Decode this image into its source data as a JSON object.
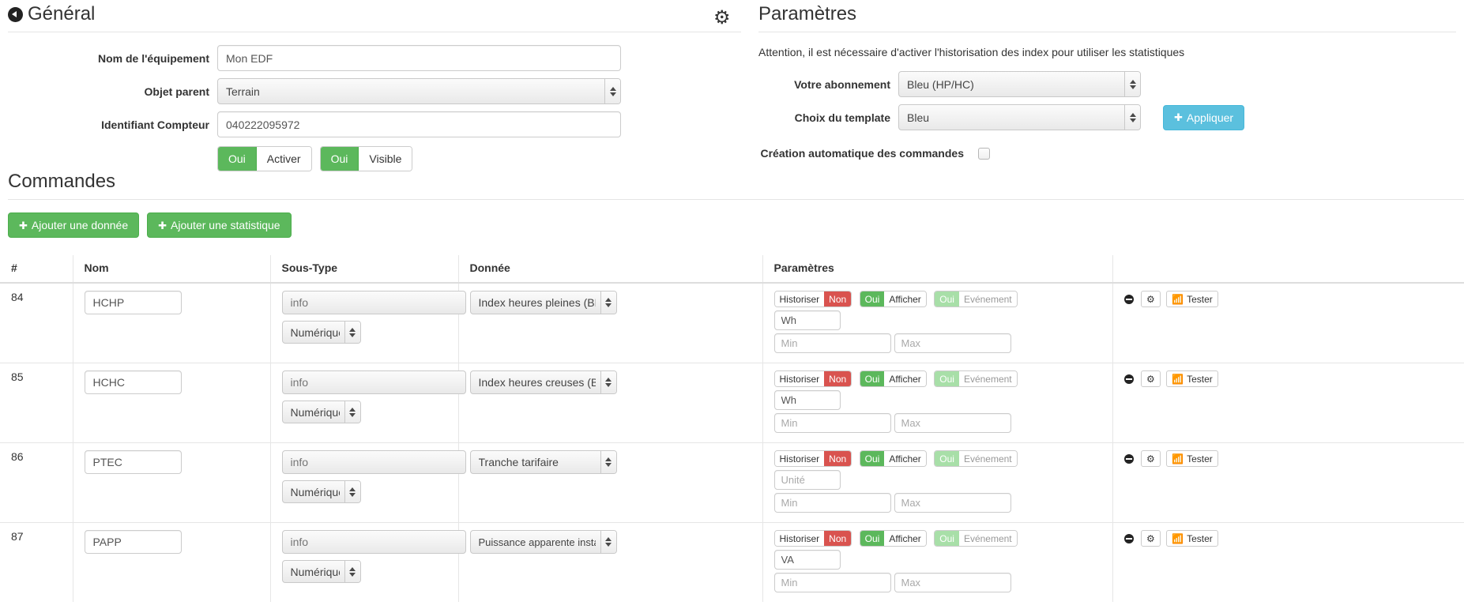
{
  "general": {
    "title": "Général",
    "back_icon": "back-arrow-icon",
    "gear_icon": "gears-icon",
    "fields": {
      "name_label": "Nom de l'équipement",
      "name_value": "Mon EDF",
      "parent_label": "Objet parent",
      "parent_value": "Terrain",
      "meter_label": "Identifiant Compteur",
      "meter_value": "040222095972"
    },
    "toggles": [
      {
        "state": "Oui",
        "label": "Activer"
      },
      {
        "state": "Oui",
        "label": "Visible"
      }
    ]
  },
  "parametres": {
    "title": "Paramètres",
    "warning": "Attention, il est nécessaire d'activer l'historisation des index pour utiliser les statistiques",
    "subscription_label": "Votre abonnement",
    "subscription_value": "Bleu (HP/HC)",
    "template_label": "Choix du template",
    "template_value": "Bleu",
    "apply_label": "Appliquer",
    "apply_icon": "plus-circle-icon",
    "auto_create_label": "Création automatique des commandes",
    "auto_create_checked": false
  },
  "commandes": {
    "title": "Commandes",
    "add_data_label": "Ajouter une donnée",
    "add_stat_label": "Ajouter une statistique",
    "columns": [
      "#",
      "Nom",
      "Sous-Type",
      "Donnée",
      "Paramètres",
      ""
    ],
    "param_labels": {
      "historiser": "Historiser",
      "historiser_state": "Non",
      "afficher": "Afficher",
      "afficher_state": "Oui",
      "evenement": "Evénement",
      "evenement_state": "Oui",
      "unit_placeholder": "Unité",
      "min_placeholder": "Min",
      "max_placeholder": "Max",
      "info_placeholder": "info"
    },
    "actions": {
      "delete_icon": "minus-circle-icon",
      "config_icon": "gears-icon",
      "test_icon": "rss-icon",
      "test_label": "Tester"
    },
    "rows": [
      {
        "id": "84",
        "nom": "HCHP",
        "sous_type_info": "",
        "sous_type_select": "Numérique",
        "donnee": "Index heures pleines (BLEU)",
        "unit": "Wh",
        "min": "",
        "max": ""
      },
      {
        "id": "85",
        "nom": "HCHC",
        "sous_type_info": "",
        "sous_type_select": "Numérique",
        "donnee": "Index heures creuses (BLEU)",
        "unit": "Wh",
        "min": "",
        "max": ""
      },
      {
        "id": "86",
        "nom": "PTEC",
        "sous_type_info": "",
        "sous_type_select": "Numérique",
        "donnee": "Tranche tarifaire",
        "unit": "",
        "min": "",
        "max": ""
      },
      {
        "id": "87",
        "nom": "PAPP",
        "sous_type_info": "",
        "sous_type_select": "Numérique",
        "donnee": "Puissance apparente instantanée",
        "unit": "VA",
        "min": "",
        "max": ""
      }
    ]
  },
  "colors": {
    "green": "#5cb85c",
    "red": "#d9534f",
    "blue": "#5bc0de",
    "green_light": "#a8dfa8"
  }
}
